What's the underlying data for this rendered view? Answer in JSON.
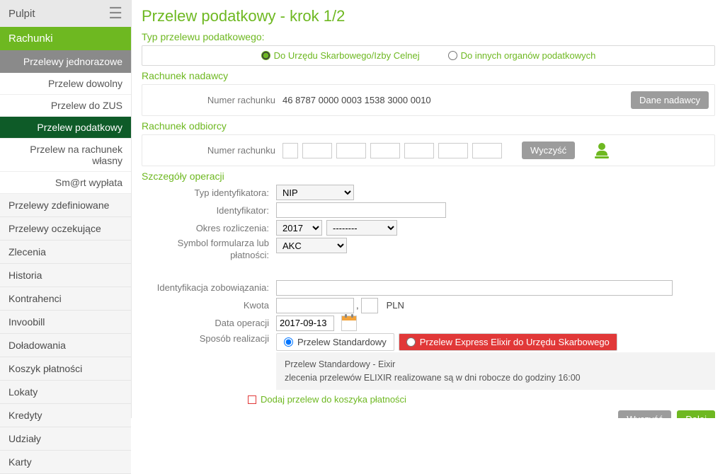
{
  "sidebar": {
    "pulpit": "Pulpit",
    "rachunki": "Rachunki",
    "sub_head": "Przelewy jednorazowe",
    "sub_items": [
      "Przelew dowolny",
      "Przelew do ZUS",
      "Przelew podatkowy",
      "Przelew na rachunek własny",
      "Sm@rt wypłata"
    ],
    "items": [
      "Przelewy zdefiniowane",
      "Przelewy oczekujące",
      "Zlecenia",
      "Historia",
      "Kontrahenci",
      "Invoobill",
      "Doładowania",
      "Koszyk płatności",
      "Lokaty",
      "Kredyty",
      "Udziały",
      "Karty"
    ]
  },
  "page": {
    "title": "Przelew podatkowy - krok 1/2",
    "type_label": "Typ przelewu podatkowego:",
    "type_urzad": "Do Urzędu Skarbowego/Izby Celnej",
    "type_inne": "Do innych organów podatkowych"
  },
  "sender": {
    "section": "Rachunek nadawcy",
    "label": "Numer rachunku",
    "value": "46 8787 0000 0003 1538 3000 0010",
    "button": "Dane nadawcy"
  },
  "receiver": {
    "section": "Rachunek odbiorcy",
    "label": "Numer rachunku",
    "button": "Wyczyść"
  },
  "details": {
    "section": "Szczegóły operacji",
    "typ_id_label": "Typ identyfikatora:",
    "typ_id_value": "NIP",
    "identyfikator_label": "Identyfikator:",
    "okres_label": "Okres rozliczenia:",
    "okres_year": "2017",
    "okres_period": "--------",
    "symbol_label": "Symbol formularza lub płatności:",
    "symbol_value": "AKC",
    "ident_zob_label": "Identyfikacja zobowiązania:",
    "kwota_label": "Kwota",
    "currency": "PLN",
    "data_label": "Data operacji",
    "data_value": "2017-09-13",
    "sposob_label": "Sposób realizacji",
    "realize_std": "Przelew Standardowy",
    "realize_express": "Przelew Express Elixir do Urzędu Skarbowego",
    "note_title": "Przelew Standardowy - Eixir",
    "note_text": "zlecenia przelewów ELIXIR realizowane są w dni robocze do godziny 16:00",
    "basket": "Dodaj przelew do koszyka płatności"
  },
  "footer": {
    "clear": "Wyczyść",
    "next": "Dalej"
  }
}
